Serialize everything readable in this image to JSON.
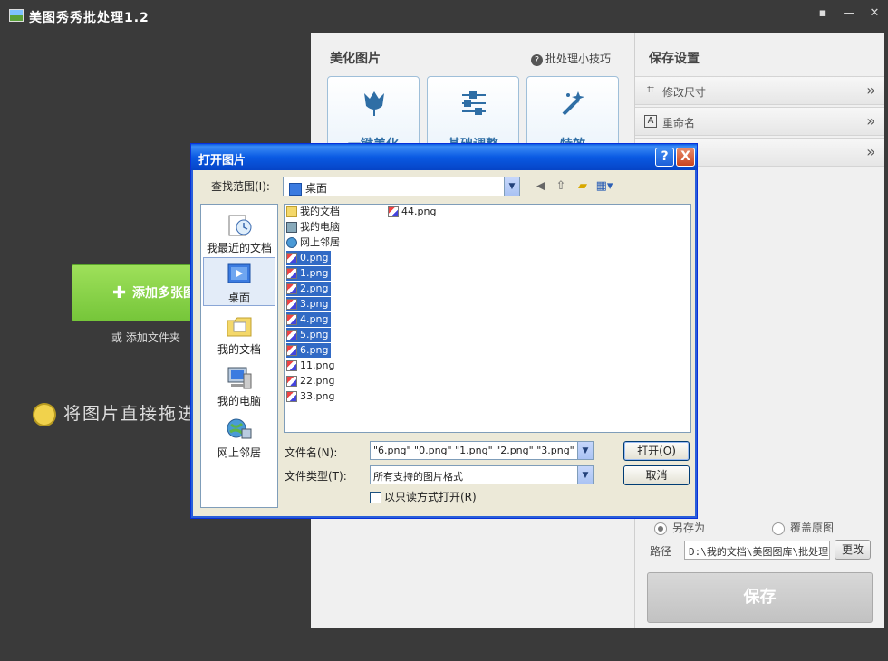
{
  "app": {
    "title": "美图秀秀批处理1.2"
  },
  "left": {
    "add_button": "添加多张图",
    "add_folder_prefix": "或",
    "add_folder_link": "添加文件夹",
    "drag_hint": "将图片直接拖进"
  },
  "beautify": {
    "title": "美化图片",
    "tips": "批处理小技巧",
    "tools": [
      {
        "label": "一键美化"
      },
      {
        "label": "基础调整"
      },
      {
        "label": "特效"
      }
    ]
  },
  "save_settings": {
    "title": "保存设置",
    "rows": [
      {
        "label": "修改尺寸",
        "icon": "crop-icon"
      },
      {
        "label": "重命名",
        "icon": "rename-icon"
      },
      {
        "label": "",
        "icon": ""
      }
    ],
    "radio_save_as": "另存为",
    "radio_overwrite": "覆盖原图",
    "path_label": "路径",
    "path_value": "D:\\我的文档\\美图图库\\批处理",
    "change_button": "更改",
    "save_button": "保存"
  },
  "dialog": {
    "title": "打开图片",
    "help": "?",
    "close": "X",
    "lookin_label": "查找范围(I):",
    "lookin_value": "桌面",
    "places": [
      {
        "label": "我最近的文档"
      },
      {
        "label": "桌面"
      },
      {
        "label": "我的文档"
      },
      {
        "label": "我的电脑"
      },
      {
        "label": "网上邻居"
      }
    ],
    "files": [
      {
        "name": "我的文档",
        "type": "folder"
      },
      {
        "name": "我的电脑",
        "type": "pc"
      },
      {
        "name": "网上邻居",
        "type": "net"
      },
      {
        "name": "0.png",
        "type": "png",
        "selected": true
      },
      {
        "name": "1.png",
        "type": "png",
        "selected": true
      },
      {
        "name": "2.png",
        "type": "png",
        "selected": true
      },
      {
        "name": "3.png",
        "type": "png",
        "selected": true
      },
      {
        "name": "4.png",
        "type": "png",
        "selected": true
      },
      {
        "name": "5.png",
        "type": "png",
        "selected": true
      },
      {
        "name": "6.png",
        "type": "png",
        "selected": true
      },
      {
        "name": "11.png",
        "type": "png"
      },
      {
        "name": "22.png",
        "type": "png"
      },
      {
        "name": "33.png",
        "type": "png"
      },
      {
        "name": "44.png",
        "type": "png"
      }
    ],
    "filename_label": "文件名(N):",
    "filename_value": "\"6.png\" \"0.png\" \"1.png\" \"2.png\" \"3.png\"",
    "filetype_label": "文件类型(T):",
    "filetype_value": "所有支持的图片格式",
    "open_button": "打开(O)",
    "cancel_button": "取消",
    "readonly_label": "以只读方式打开(R)"
  }
}
